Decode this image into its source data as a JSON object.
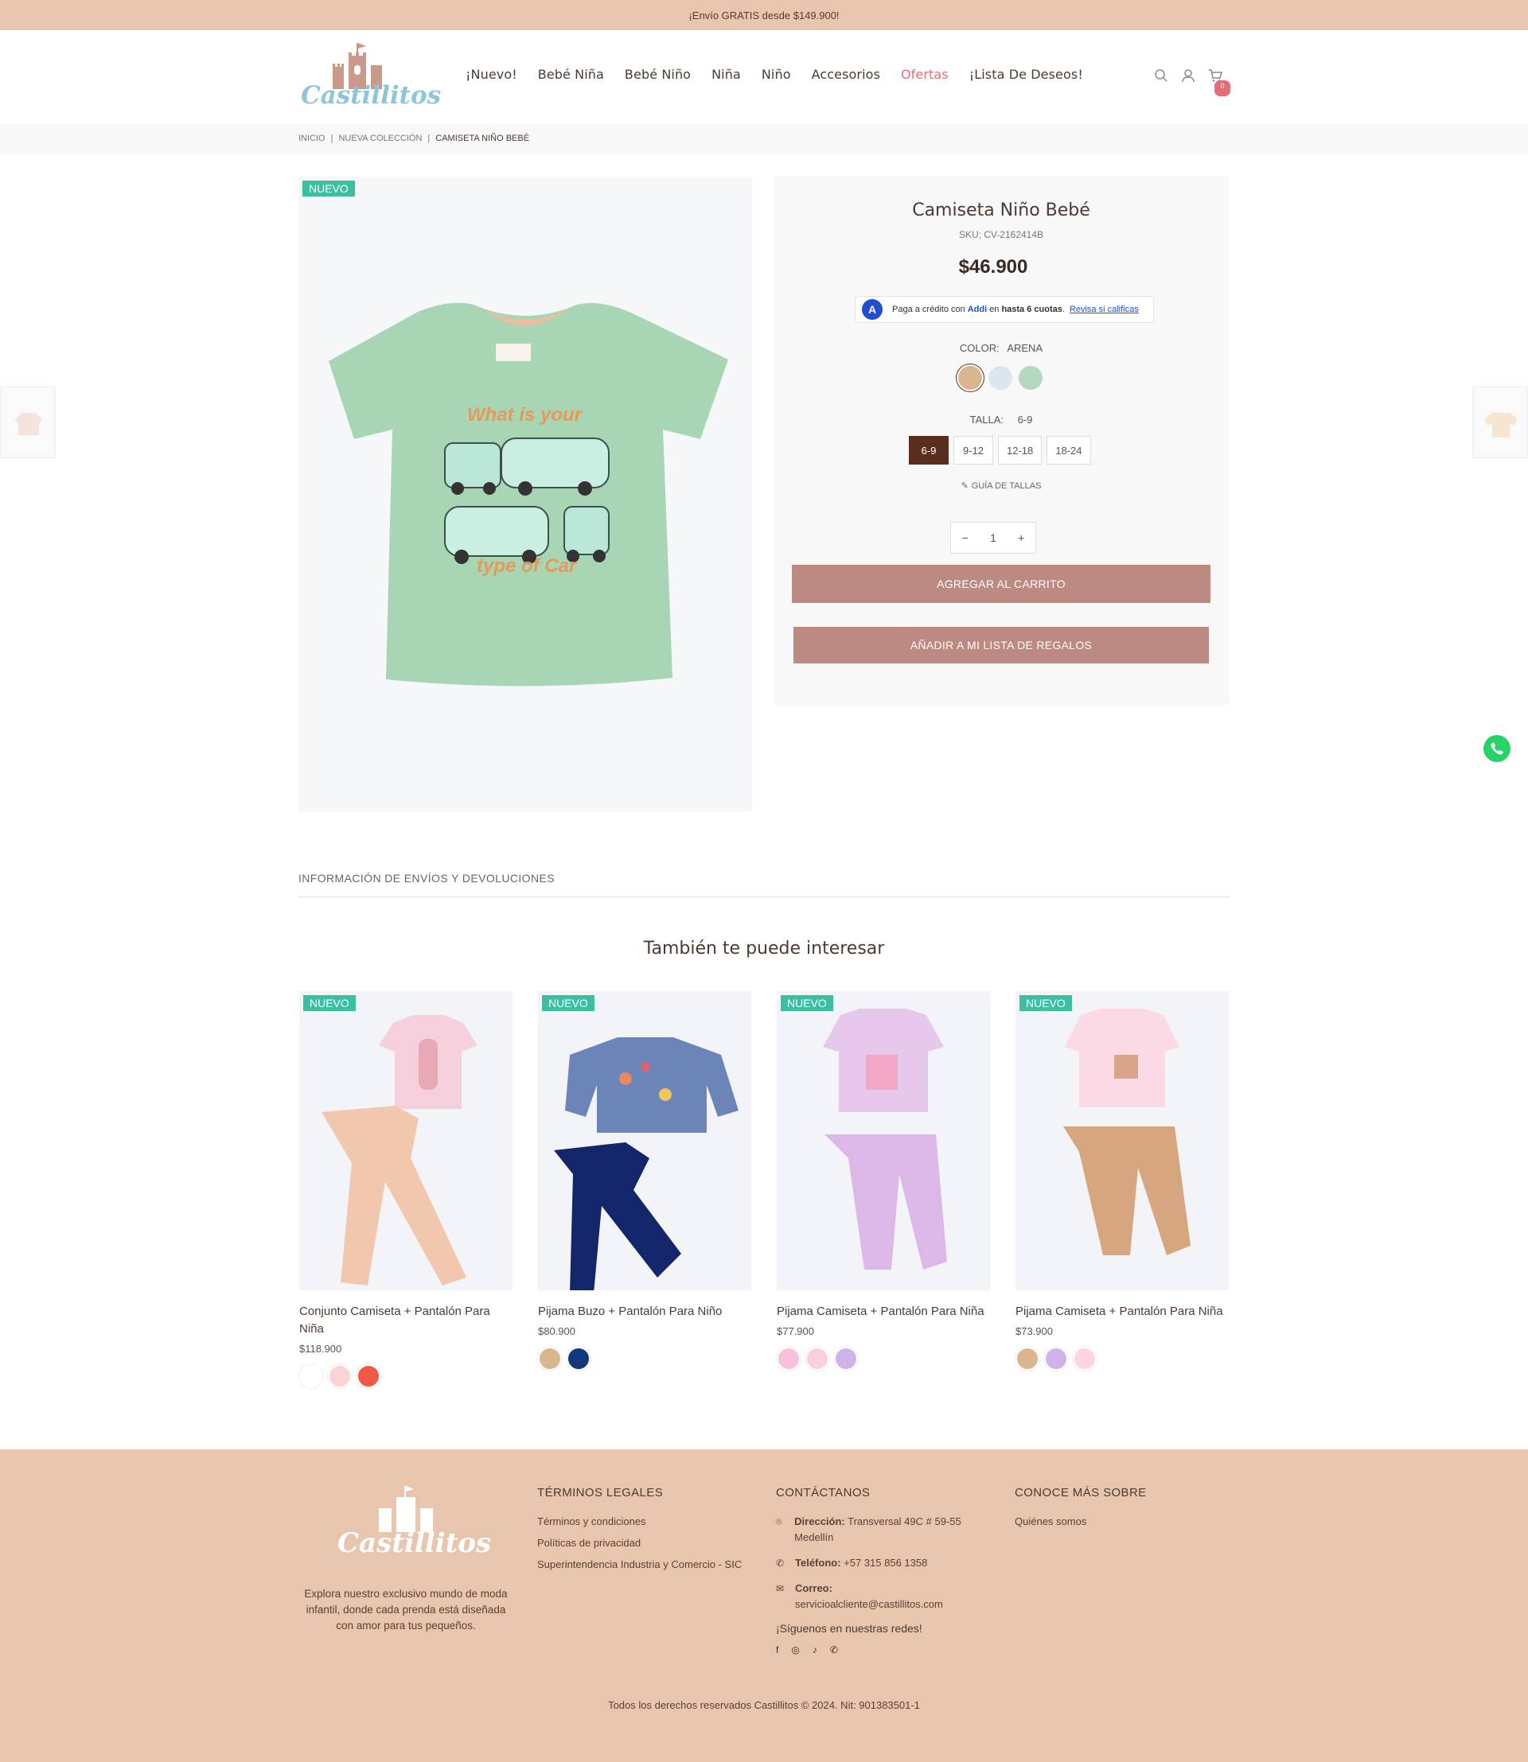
{
  "topbar": {
    "text": "¡Envío GRATIS desde $149.900!"
  },
  "nav": {
    "items": [
      "¡Nuevo!",
      "Bebé Niña",
      "Bebé Niño",
      "Niña",
      "Niño",
      "Accesorios",
      "Ofertas",
      "¡Lista De Deseos!"
    ],
    "cart_count": "0"
  },
  "breadcrumb": {
    "items": [
      "INICIO",
      "NUEVA COLECCIÓN",
      "CAMISETA NIÑO BEBÉ"
    ],
    "separator": "|"
  },
  "product": {
    "badge": "NUEVO",
    "name": "Camiseta Niño Bebé",
    "sku": "SKU; CV-2162414B",
    "price": "$46.900",
    "addi": {
      "prefix": "Paga a crédito con",
      "brand": "Addi",
      "mid": "en",
      "bold": "hasta 6 cuotas",
      "dot": ".",
      "link": "Revisa si calificas"
    },
    "color_label": "COLOR:",
    "color_value": "ARENA",
    "colors": [
      "#d9b590",
      "#d8e8ec",
      "#b6d7c0"
    ],
    "size_label": "TALLA:",
    "size_value": "6-9",
    "sizes": [
      "6-9",
      "9-12",
      "12-18",
      "18-24"
    ],
    "size_guide": "GUÍA DE TALLAS",
    "quantity": "1",
    "add_to_cart": "AGREGAR AL CARRITO",
    "gift_list": "AÑADIR A MI LISTA DE REGALOS",
    "shirt_text_top": "What is your",
    "shirt_text_bottom": "type of Car"
  },
  "info_section": "INFORMACIÓN DE ENVÍOS Y DEVOLUCIONES",
  "related": {
    "title": "También te puede interesar",
    "items": [
      {
        "badge": "NUEVO",
        "name": "Conjunto Camiseta + Pantalón Para Niña",
        "price": "$118.900",
        "colors": [
          "#ffffff",
          "#fbd3d3",
          "#ee5a45"
        ]
      },
      {
        "badge": "NUEVO",
        "name": "Pijama Buzo + Pantalón Para Niño",
        "price": "$80.900",
        "colors": [
          "#d9b590",
          "#13367c"
        ]
      },
      {
        "badge": "NUEVO",
        "name": "Pijama Camiseta + Pantalón Para Niña",
        "price": "$77.900",
        "colors": [
          "#f7c1dc",
          "#f9d0dc",
          "#cfb3e8"
        ]
      },
      {
        "badge": "NUEVO",
        "name": "Pijama Camiseta + Pantalón Para Niña",
        "price": "$73.900",
        "colors": [
          "#d9b590",
          "#cfb3e8",
          "#fbd6e0"
        ]
      }
    ]
  },
  "footer": {
    "description": "Explora nuestro exclusivo mundo de moda infantil, donde cada prenda está diseñada con amor para tus pequeños.",
    "legal_title": "TÉRMINOS LEGALES",
    "legal_links": [
      "Términos y condiciones",
      "Políticas de privacidad",
      "Superintendencia Industria y Comercio - SIC"
    ],
    "contact_title": "CONTÁCTANOS",
    "address_label": "Dirección:",
    "address": "Transversal 49C # 59-55 Medellín",
    "phone_label": "Teléfono:",
    "phone": "+57 315 856 1358",
    "email_label": "Correo:",
    "email": "servicioalcliente@castillitos.com",
    "social_title": "¡Síguenos en nuestras redes!",
    "about_title": "CONOCE MÁS SOBRE",
    "about_links": [
      "Quiénes somos"
    ],
    "copyright": "Todos los derechos reservados Castillitos © 2024. Nit: 901383501-1"
  },
  "logo_text": "Castillitos"
}
